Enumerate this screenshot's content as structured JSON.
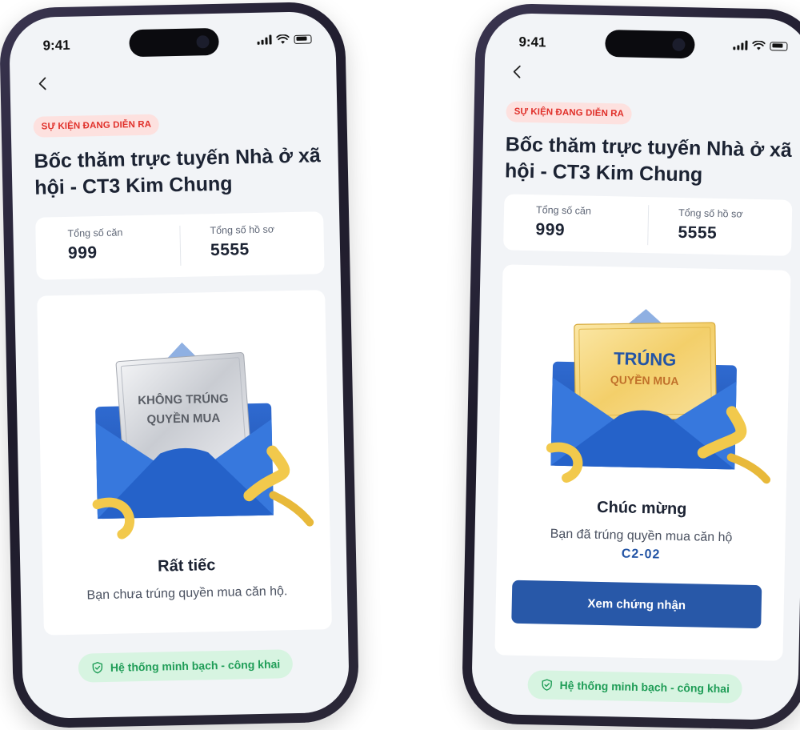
{
  "status_bar": {
    "time": "9:41"
  },
  "left_screen": {
    "badge": "SỰ KIỆN ĐANG DIỄN RA",
    "title": "Bốc thăm trực tuyến Nhà ở xã hội - CT3 Kim Chung",
    "stats": [
      {
        "label": "Tổng số căn",
        "value": "999"
      },
      {
        "label": "Tổng số hồ sơ",
        "value": "5555"
      }
    ],
    "ticket_line1": "KHÔNG TRÚNG",
    "ticket_line2": "QUYỀN MUA",
    "result_title": "Rất tiếc",
    "result_text": "Bạn chưa trúng quyền mua căn hộ.",
    "footer_badge": "Hệ thống minh bạch - công khai"
  },
  "right_screen": {
    "badge": "SỰ KIỆN ĐANG DIỄN RA",
    "title": "Bốc thăm trực tuyến Nhà ở xã hội - CT3 Kim Chung",
    "stats": [
      {
        "label": "Tổng số căn",
        "value": "999"
      },
      {
        "label": "Tổng số hồ sơ",
        "value": "5555"
      }
    ],
    "ticket_line1": "TRÚNG",
    "ticket_line2": "QUYỀN MUA",
    "result_title": "Chúc mừng",
    "result_text": "Bạn đã trúng quyền mua căn hộ",
    "apartment_code": "C2-02",
    "cta_label": "Xem chứng nhận",
    "footer_badge": "Hệ thống minh bạch - công khai"
  },
  "colors": {
    "accent": "#2858a8",
    "badge_red": "#e0302a",
    "trust_green": "#1f9d57",
    "ribbon_gold": "#f2c94c",
    "envelope_blue": "#2a62c4"
  },
  "icons": {
    "back": "chevron-left-icon",
    "shield": "shield-check-icon",
    "signal": "signal-icon",
    "wifi": "wifi-icon",
    "battery": "battery-icon"
  }
}
